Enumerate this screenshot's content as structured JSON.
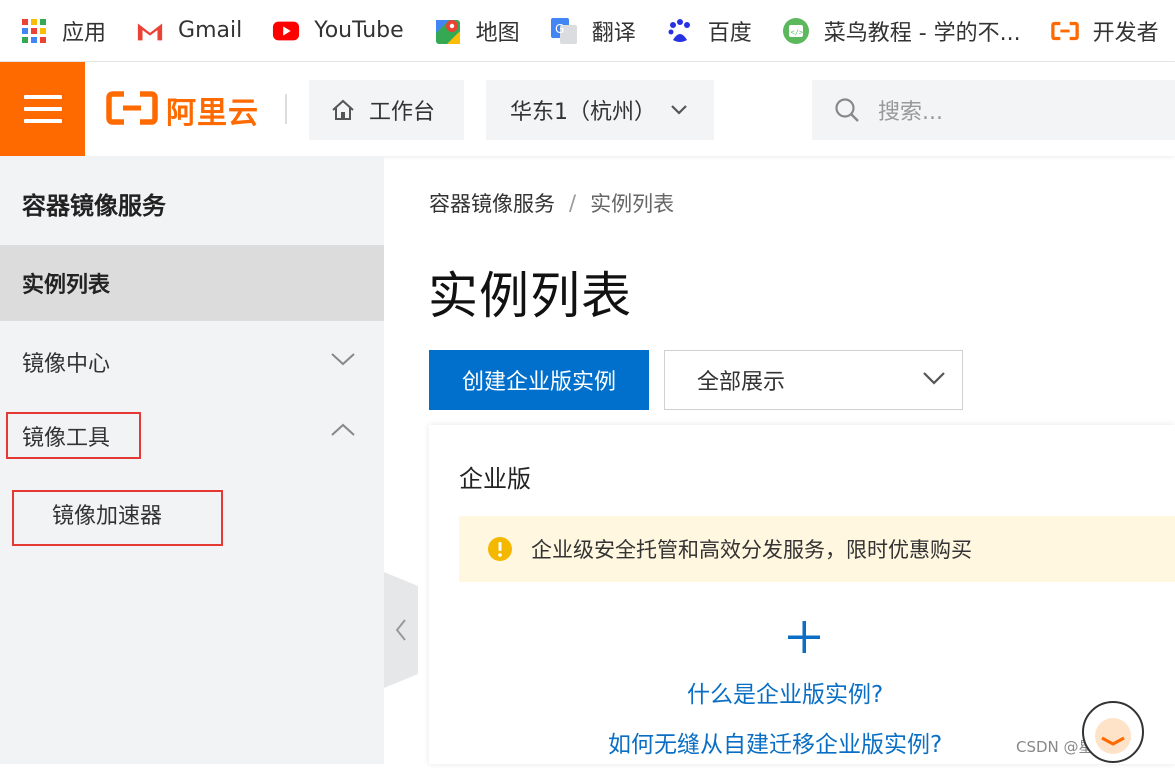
{
  "bookmarks": [
    {
      "label": "应用",
      "icon": "apps-grid-icon"
    },
    {
      "label": "Gmail",
      "icon": "gmail-icon"
    },
    {
      "label": "YouTube",
      "icon": "youtube-icon"
    },
    {
      "label": "地图",
      "icon": "maps-icon"
    },
    {
      "label": "翻译",
      "icon": "translate-icon"
    },
    {
      "label": "百度",
      "icon": "baidu-icon"
    },
    {
      "label": "菜鸟教程 - 学的不...",
      "icon": "runoob-icon"
    },
    {
      "label": "开发者",
      "icon": "aliyun-dev-icon"
    }
  ],
  "header": {
    "logo_text": "阿里云",
    "workbench_label": "工作台",
    "region_label": "华东1（杭州）",
    "search_placeholder": "搜索..."
  },
  "sidebar": {
    "title": "容器镜像服务",
    "items": [
      {
        "label": "实例列表",
        "active": true
      },
      {
        "label": "镜像中心",
        "expanded": false
      },
      {
        "label": "镜像工具",
        "expanded": true
      }
    ],
    "sub_item": "镜像加速器"
  },
  "main": {
    "breadcrumb": [
      "容器镜像服务",
      "实例列表"
    ],
    "breadcrumb_sep": "/",
    "page_title": "实例列表",
    "create_button": "创建企业版实例",
    "filter_select": "全部展示",
    "card": {
      "title": "企业版",
      "notice": "企业级安全托管和高效分发服务，限时优惠购买",
      "link_what": "什么是企业版实例?",
      "link_migrate": "如何无缝从自建迁移企业版实例?"
    }
  },
  "watermark": "CSDN @星河@@",
  "colors": {
    "brand_orange": "#ff6a00",
    "primary_blue": "#0070cc",
    "link_blue": "#0a6fc4",
    "highlight_red": "#e53935",
    "notice_bg": "#fff7e0",
    "warning_yellow": "#f5b800"
  }
}
